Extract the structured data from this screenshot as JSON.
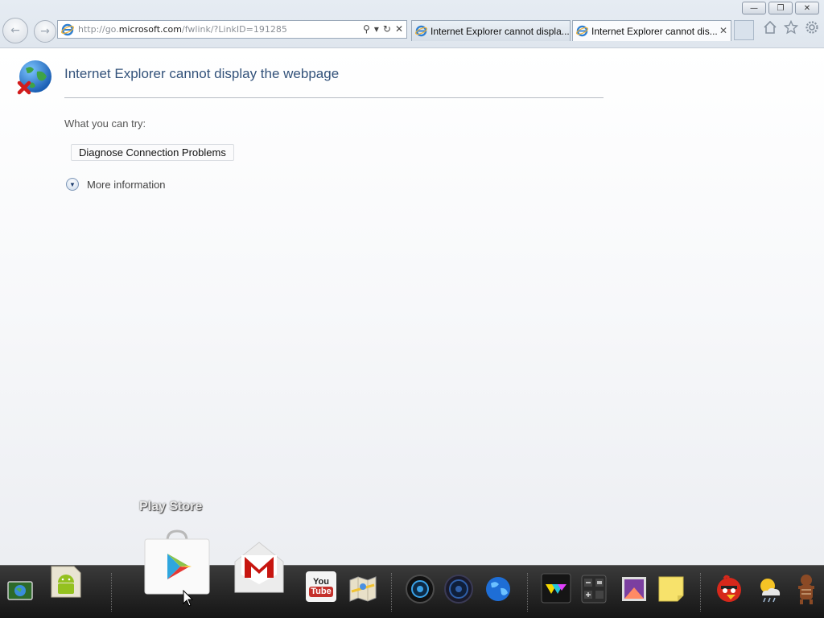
{
  "window": {
    "minimize_glyph": "—",
    "restore_glyph": "❐",
    "close_glyph": "✕"
  },
  "nav": {
    "back_glyph": "←",
    "forward_glyph": "→"
  },
  "address_bar": {
    "url_prefix": "http://go.",
    "url_domain": "microsoft.com",
    "url_suffix": "/fwlink/?LinkID=191285",
    "search_glyph": "⚲",
    "dropdown_glyph": "▾",
    "refresh_glyph": "↻",
    "stop_glyph": "✕"
  },
  "tabs": [
    {
      "title": "Internet Explorer cannot displa...",
      "active": false
    },
    {
      "title": "Internet Explorer cannot dis...",
      "active": true,
      "close_glyph": "✕"
    }
  ],
  "toolbar_icons": [
    "home-icon",
    "favorites-star-icon",
    "settings-gear-icon"
  ],
  "page": {
    "title": "Internet Explorer cannot display the webpage",
    "try_label": "What you can try:",
    "diagnose_button": "Diagnose Connection Problems",
    "more_info": "More information"
  },
  "dock": {
    "hover_label": "Play Store",
    "apps": [
      "desktop-icon",
      "android-icon",
      "play-store-icon",
      "gmail-icon",
      "youtube-icon",
      "maps-icon",
      "camera-icon",
      "speaker-icon",
      "browser-icon",
      "gallery-icon",
      "calculator-icon",
      "photo-icon",
      "notes-icon",
      "angry-birds-icon",
      "weather-icon",
      "gingerbread-icon"
    ],
    "youtube_label_top": "You",
    "youtube_label_bottom": "Tube"
  },
  "colors": {
    "title_blue": "#33527a",
    "dock_bg": "#1e1e1e",
    "gmail_red": "#c71610",
    "play_green": "#3fb68b"
  }
}
